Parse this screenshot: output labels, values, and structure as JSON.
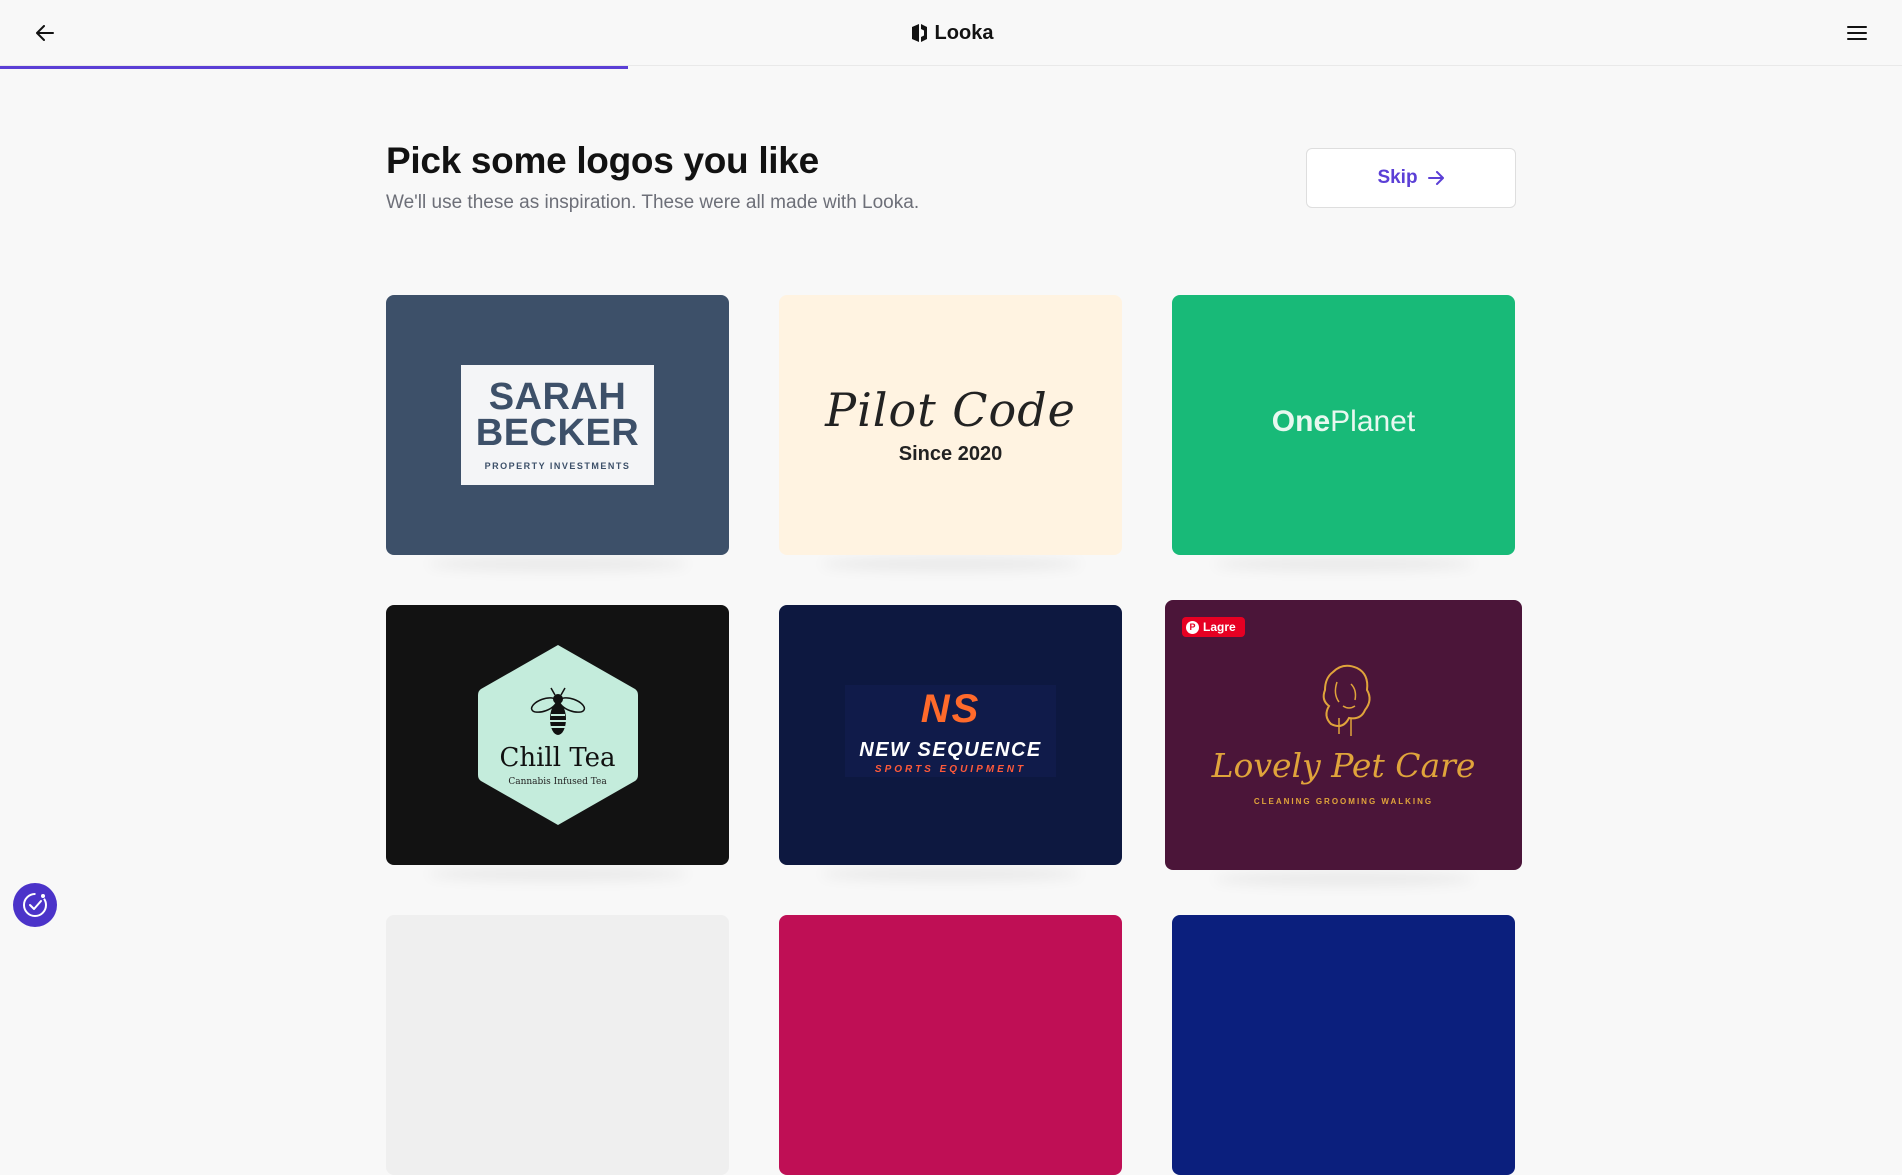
{
  "header": {
    "brand_name": "Looka",
    "back_icon": "arrow-left-icon",
    "menu_icon": "hamburger-menu-icon",
    "progress_fraction": 0.33
  },
  "intro": {
    "title": "Pick some logos you like",
    "subtitle": "We'll use these as inspiration. These were all made with Looka.",
    "skip_label": "Skip"
  },
  "logos": [
    {
      "name_line1": "SARAH",
      "name_line2": "BECKER",
      "tagline": "PROPERTY INVESTMENTS",
      "background": "#3d5069"
    },
    {
      "name": "Pilot Code",
      "tagline": "Since 2020",
      "background": "#fff3e1"
    },
    {
      "name_part1": "One",
      "name_part2": "Planet",
      "background": "#18ba78"
    },
    {
      "name": "Chill Tea",
      "tagline": "Cannabis Infused Tea",
      "background": "#121212"
    },
    {
      "mark": "NS",
      "name": "NEW SEQUENCE",
      "tagline": "SPORTS EQUIPMENT",
      "background": "#0d1840"
    },
    {
      "name": "Lovely Pet Care",
      "tagline": "CLEANING   GROOMING   WALKING",
      "badge": "Lagre",
      "background": "#4b1539"
    }
  ],
  "partial_logos": [
    {
      "background": "#efefef"
    },
    {
      "background": "#bf0f55"
    },
    {
      "background": "#0b1f7d"
    }
  ],
  "colors": {
    "accent": "#5b3fd6",
    "pinterest": "#e60023"
  },
  "assistant_icon": "check-badge-icon"
}
